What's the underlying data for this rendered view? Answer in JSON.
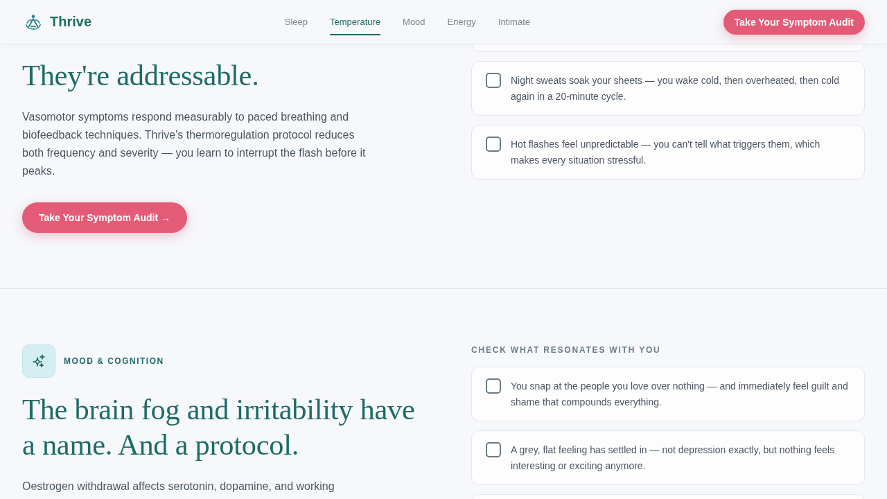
{
  "header": {
    "logo": "Thrive",
    "nav": [
      {
        "label": "Sleep",
        "selected": false
      },
      {
        "label": "Temperature",
        "selected": true
      },
      {
        "label": "Mood",
        "selected": false
      },
      {
        "label": "Energy",
        "selected": false
      },
      {
        "label": "Intimate",
        "selected": false
      }
    ],
    "cta": "Take Your Symptom Audit"
  },
  "sections": [
    {
      "heading": "They're addressable.",
      "body": "Vasomotor symptoms respond measurably to paced breathing and biofeedback techniques. Thrive's thermoregulation protocol reduces both frequency and severity — you learn to interrupt the flash before it peaks.",
      "cta": "Take Your Symptom Audit →",
      "checklist": [
        {
          "text": "Night sweats soak your sheets — you wake cold, then overheated, then cold again in a 20-minute cycle.",
          "checked": false
        },
        {
          "text": "Hot flashes feel unpredictable — you can't tell what triggers them, which makes every situation stressful.",
          "checked": false
        }
      ]
    },
    {
      "tag": "MOOD & COGNITION",
      "heading": "The brain fog and irritability have a name. And a protocol.",
      "body": "Oestrogen withdrawal affects serotonin, dopamine, and working",
      "checklist_title": "CHECK WHAT RESONATES WITH YOU",
      "checklist": [
        {
          "text": "You snap at the people you love over nothing — and immediately feel guilt and shame that compounds everything.",
          "checked": false
        },
        {
          "text": "A grey, flat feeling has settled in — not depression exactly, but nothing feels interesting or exciting anymore.",
          "checked": false
        }
      ]
    }
  ]
}
